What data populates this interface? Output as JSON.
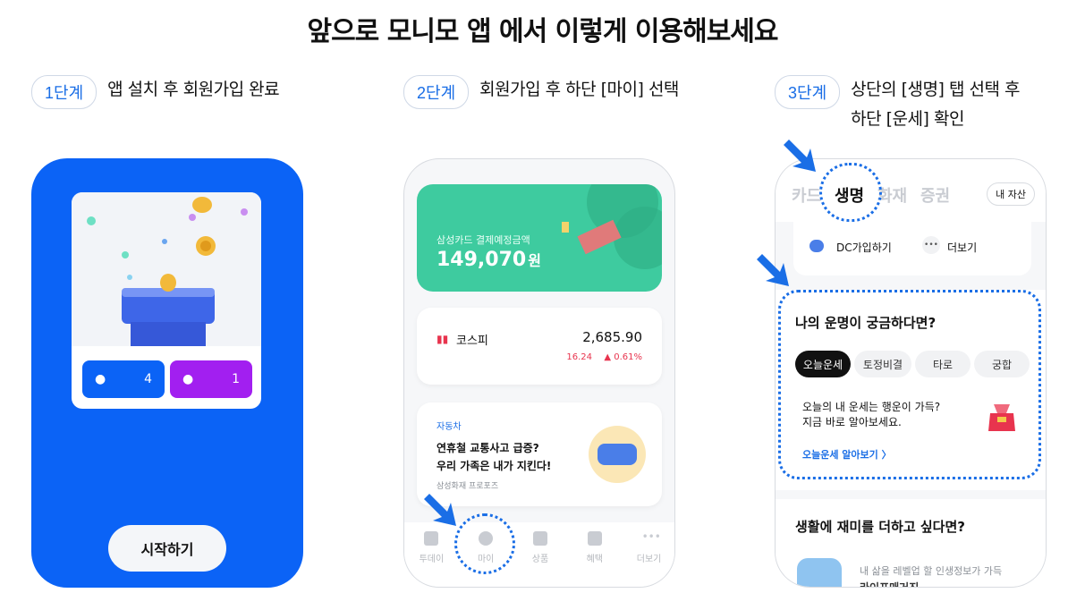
{
  "page": {
    "title": "앞으로 모니모 앱 에서 이렇게 이용해보세요"
  },
  "steps": [
    {
      "badge": "1단계",
      "text": "앱 설치 후 회원가입 완료",
      "text2": ""
    },
    {
      "badge": "2단계",
      "text": "회원가입 후 하단 [마이] 선택",
      "text2": ""
    },
    {
      "badge": "3단계",
      "text": "상단의 [생명] 탭 선택 후",
      "text2": "하단 [운세] 확인"
    }
  ],
  "phone1": {
    "btn_left_value": "4",
    "btn_right_value": "1",
    "start_label": "시작하기",
    "colors": {
      "bg": "#0b63f6",
      "left_btn": "#0b63f6",
      "right_btn": "#a21ff0"
    }
  },
  "phone2": {
    "green_card": {
      "label": "삼성카드 결제예정금액",
      "amount": "149,070",
      "unit": "원"
    },
    "stock_card": {
      "name": "코스피",
      "value": "2,685.90",
      "change": "16.24",
      "change_pct": "▲ 0.61%"
    },
    "news_card": {
      "category": "자동차",
      "headline1": "연휴철 교통사고 급증?",
      "headline2": "우리 가족은 내가 지킨다!",
      "source": "삼성화재 프로포즈"
    },
    "tabs": [
      {
        "label": "투데이",
        "icon": "today-icon"
      },
      {
        "label": "마이",
        "icon": "person-icon"
      },
      {
        "label": "상품",
        "icon": "bag-icon"
      },
      {
        "label": "혜택",
        "icon": "party-icon"
      },
      {
        "label": "더보기",
        "icon": "more-icon"
      }
    ]
  },
  "phone3": {
    "tabs": [
      "카드",
      "생명",
      "화재",
      "증권"
    ],
    "my_assets": "내 자산",
    "dc_label": "DC가입하기",
    "more_label": "더보기",
    "fortune": {
      "title": "나의 운명이 궁금하다면?",
      "chips": [
        "오늘운세",
        "토정비결",
        "타로",
        "궁합"
      ],
      "body1": "오늘의 내 운세는 행운이 가득?",
      "body2": "지금 바로 알아보세요.",
      "link": "오늘운세 알아보기 〉"
    },
    "fun": {
      "title": "생활에 재미를 더하고 싶다면?",
      "sub1": "내 삶을 레벨업 할 인생정보가 가득",
      "sub2": "라이프매거진"
    }
  },
  "colors": {
    "accent": "#1a6ee6",
    "green": "#3ecb9f",
    "up": "#e8344e"
  }
}
